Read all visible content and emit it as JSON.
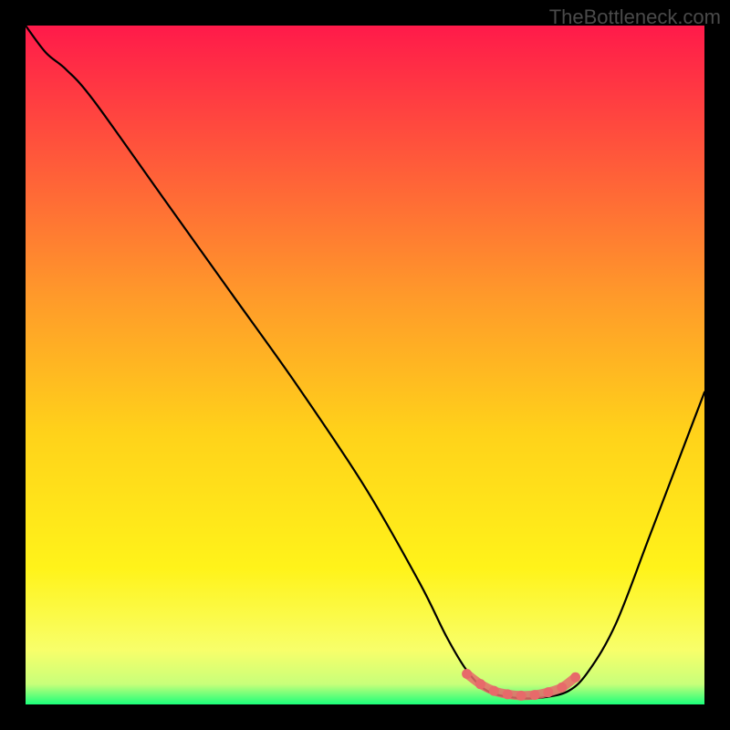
{
  "watermark": "TheBottleneck.com",
  "chart_data": {
    "type": "line",
    "title": "",
    "xlabel": "",
    "ylabel": "",
    "xlim": [
      0,
      100
    ],
    "ylim": [
      0,
      100
    ],
    "gradient_stops": [
      {
        "offset": 0,
        "color": "#ff1a4a"
      },
      {
        "offset": 20,
        "color": "#ff5a3a"
      },
      {
        "offset": 40,
        "color": "#ff9a2a"
      },
      {
        "offset": 60,
        "color": "#ffd21a"
      },
      {
        "offset": 80,
        "color": "#fff31a"
      },
      {
        "offset": 92,
        "color": "#f8ff6a"
      },
      {
        "offset": 97,
        "color": "#c8ff7a"
      },
      {
        "offset": 100,
        "color": "#1aff7a"
      }
    ],
    "series": [
      {
        "name": "curve",
        "points": [
          {
            "x": 0,
            "y": 100
          },
          {
            "x": 3,
            "y": 96
          },
          {
            "x": 6,
            "y": 93.5
          },
          {
            "x": 10,
            "y": 89
          },
          {
            "x": 20,
            "y": 75
          },
          {
            "x": 30,
            "y": 61
          },
          {
            "x": 40,
            "y": 47
          },
          {
            "x": 50,
            "y": 32
          },
          {
            "x": 58,
            "y": 18
          },
          {
            "x": 62,
            "y": 10
          },
          {
            "x": 65,
            "y": 5
          },
          {
            "x": 68,
            "y": 2
          },
          {
            "x": 72,
            "y": 1
          },
          {
            "x": 76,
            "y": 1
          },
          {
            "x": 80,
            "y": 2
          },
          {
            "x": 83,
            "y": 5
          },
          {
            "x": 87,
            "y": 12
          },
          {
            "x": 92,
            "y": 25
          },
          {
            "x": 100,
            "y": 46
          }
        ]
      }
    ],
    "highlight_dots": [
      {
        "x": 65,
        "y": 4.5
      },
      {
        "x": 67,
        "y": 3
      },
      {
        "x": 69,
        "y": 2
      },
      {
        "x": 71,
        "y": 1.5
      },
      {
        "x": 73,
        "y": 1.3
      },
      {
        "x": 75,
        "y": 1.4
      },
      {
        "x": 77,
        "y": 1.8
      },
      {
        "x": 79,
        "y": 2.5
      },
      {
        "x": 81,
        "y": 4
      }
    ],
    "highlight_color": "#e76a6a"
  }
}
